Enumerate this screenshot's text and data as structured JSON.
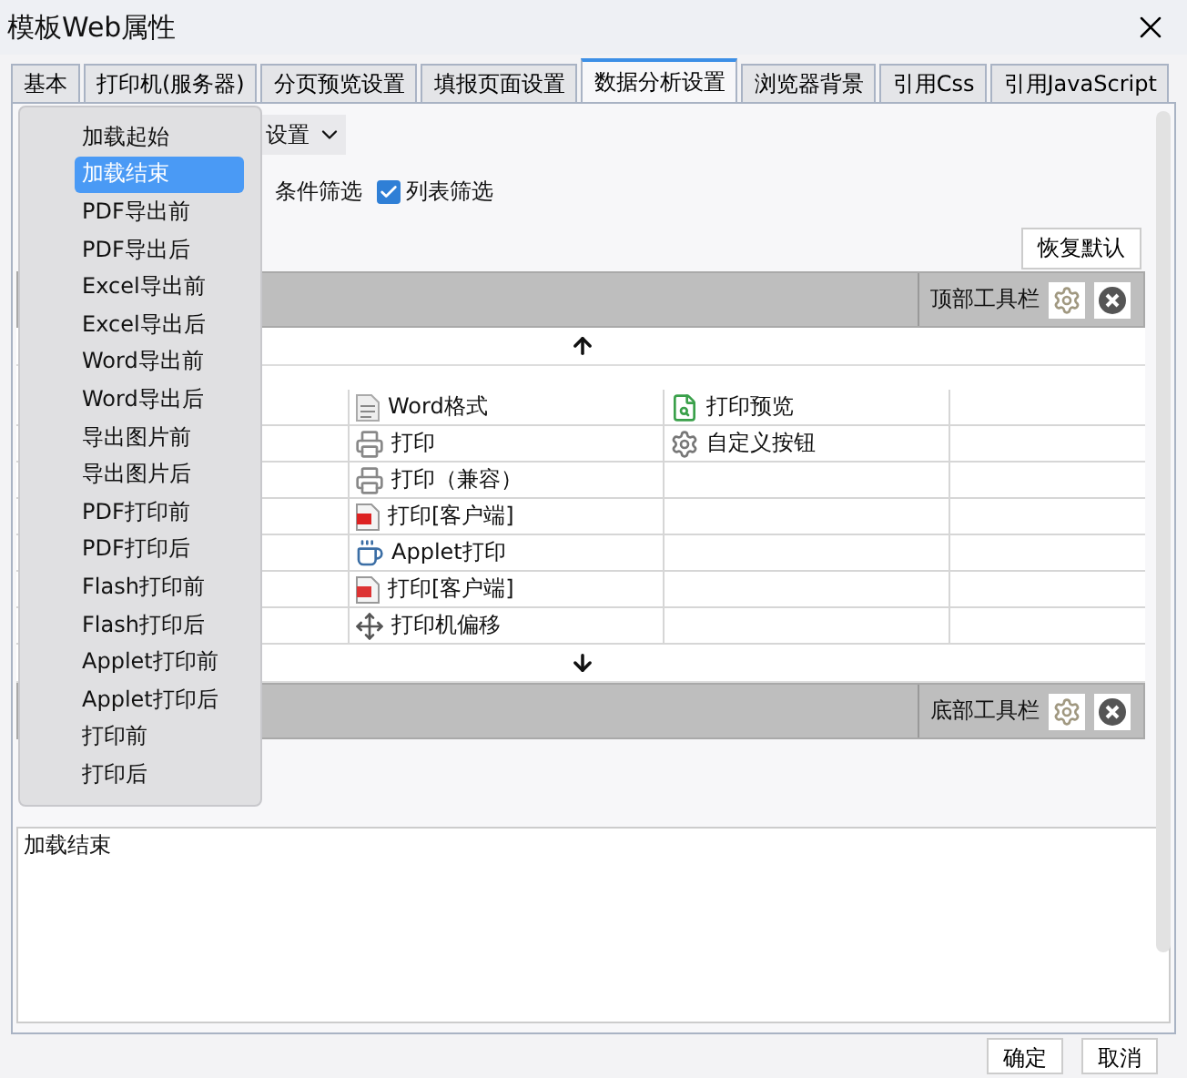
{
  "window": {
    "title": "模板Web属性"
  },
  "tabs": [
    {
      "label": "基本",
      "selected": false
    },
    {
      "label": "打印机(服务器)",
      "selected": false
    },
    {
      "label": "分页预览设置",
      "selected": false
    },
    {
      "label": "填报页面设置",
      "selected": false
    },
    {
      "label": "数据分析设置",
      "selected": true
    },
    {
      "label": "浏览器背景",
      "selected": false
    },
    {
      "label": "引用Css",
      "selected": false
    },
    {
      "label": "引用JavaScript",
      "selected": false
    }
  ],
  "settings_combo": {
    "value": "设置"
  },
  "filters": [
    {
      "kind": "label",
      "label": "条件筛选"
    },
    {
      "kind": "checkbox",
      "label": "列表筛选",
      "checked": true
    }
  ],
  "restore_button": "恢复默认",
  "top_toolbar": {
    "label": "顶部工具栏"
  },
  "button_grid": {
    "rows": [
      [
        {
          "kind": "word",
          "label": "Word格式"
        },
        {
          "kind": "preview",
          "label": "打印预览"
        }
      ],
      [
        {
          "kind": "printer",
          "label": "打印"
        },
        {
          "kind": "gear",
          "label": "自定义按钮"
        }
      ],
      [
        {
          "kind": "printer",
          "label": "打印（兼容）"
        }
      ],
      [
        {
          "kind": "flash",
          "label": "打印[客户端]"
        }
      ],
      [
        {
          "kind": "applet",
          "label": "Applet打印"
        }
      ],
      [
        {
          "kind": "pdf",
          "label": "打印[客户端]"
        }
      ],
      [
        {
          "kind": "move",
          "label": "打印机偏移"
        }
      ]
    ]
  },
  "bottom_toolbar": {
    "label": "底部工具栏"
  },
  "event_menu": [
    {
      "label": "加载起始",
      "selected": false
    },
    {
      "label": "加载结束",
      "selected": true
    },
    {
      "label": "PDF导出前",
      "selected": false
    },
    {
      "label": "PDF导出后",
      "selected": false
    },
    {
      "label": "Excel导出前",
      "selected": false
    },
    {
      "label": "Excel导出后",
      "selected": false
    },
    {
      "label": "Word导出前",
      "selected": false
    },
    {
      "label": "Word导出后",
      "selected": false
    },
    {
      "label": "导出图片前",
      "selected": false
    },
    {
      "label": "导出图片后",
      "selected": false
    },
    {
      "label": "PDF打印前",
      "selected": false
    },
    {
      "label": "PDF打印后",
      "selected": false
    },
    {
      "label": "Flash打印前",
      "selected": false
    },
    {
      "label": "Flash打印后",
      "selected": false
    },
    {
      "label": "Applet打印前",
      "selected": false
    },
    {
      "label": "Applet打印后",
      "selected": false
    },
    {
      "label": "打印前",
      "selected": false
    },
    {
      "label": "打印后",
      "selected": false
    }
  ],
  "script_editor": {
    "value": "加载结束"
  },
  "footer_buttons": [
    "确定",
    "取消"
  ]
}
